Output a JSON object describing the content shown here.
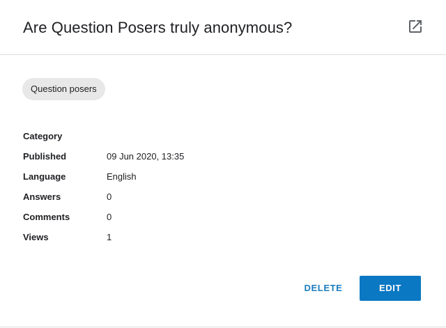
{
  "dialog": {
    "title": "Are Question Posers truly anonymous?",
    "open_icon": "open-in-new-icon"
  },
  "tag": {
    "label": "Question posers"
  },
  "details": [
    {
      "key": "Category",
      "value": ""
    },
    {
      "key": "Published",
      "value": "09 Jun 2020, 13:35"
    },
    {
      "key": "Language",
      "value": "English"
    },
    {
      "key": "Answers",
      "value": "0"
    },
    {
      "key": "Comments",
      "value": "0"
    },
    {
      "key": "Views",
      "value": "1"
    }
  ],
  "actions": {
    "delete_label": "DELETE",
    "edit_label": "EDIT"
  },
  "colors": {
    "accent": "#0b78c3",
    "link": "#1a7cc0",
    "chip_bg": "#e8e8e8"
  }
}
